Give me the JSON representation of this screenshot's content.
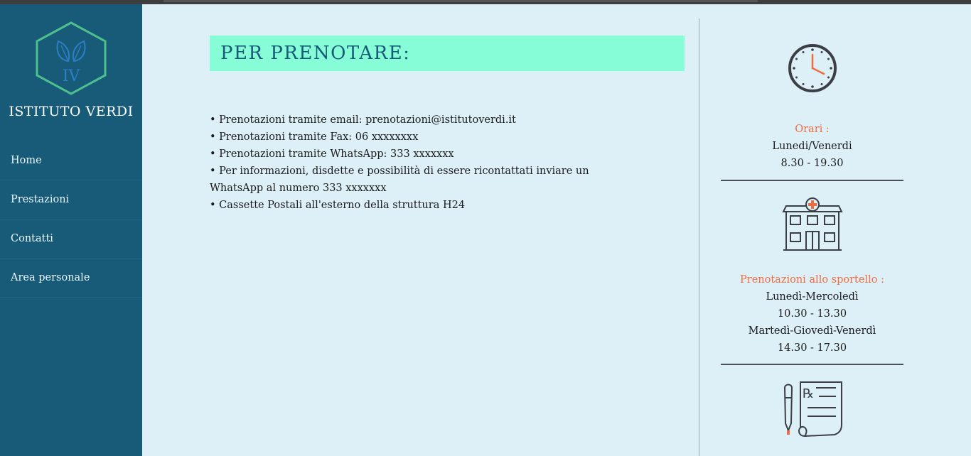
{
  "sidebar": {
    "logo_text": "IV",
    "brand": "ISTITUTO VERDI",
    "nav": [
      "Home",
      "Prestazioni",
      "Contatti",
      "Area personale"
    ]
  },
  "main": {
    "title": "PER PRENOTARE:",
    "lines": [
      "• Prenotazioni tramite email: prenotazioni@istitutoverdi.it",
      "• Prenotazioni tramite Fax: 06 xxxxxxxx",
      "• Prenotazioni tramite WhatsApp: 333 xxxxxxx",
      "• Per informazioni, disdette e possibilità di essere ricontattati inviare un WhatsApp al numero 333 xxxxxxx",
      "• Cassette Postali all'esterno della struttura H24"
    ]
  },
  "aside": {
    "orari_label": "Orari :",
    "orari_days": "Lunedi/Venerdi",
    "orari_hours": "8.30 - 19.30",
    "sportello_label": "Prenotazioni allo sportello :",
    "sportello_days1": "Lunedì-Mercoledì",
    "sportello_hours1": "10.30 - 13.30",
    "sportello_days2": "Martedì-Giovedì-Venerdì",
    "sportello_hours2": "14.30 - 17.30"
  },
  "colors": {
    "sidebar": "#175b78",
    "background": "#ddf0f8",
    "title_box": "#86fdd6",
    "accent": "#ef6c3f",
    "logo_hex": "#4fc08d"
  },
  "icons": [
    "leaf-logo-icon",
    "clock-icon",
    "hospital-icon",
    "prescription-icon"
  ]
}
